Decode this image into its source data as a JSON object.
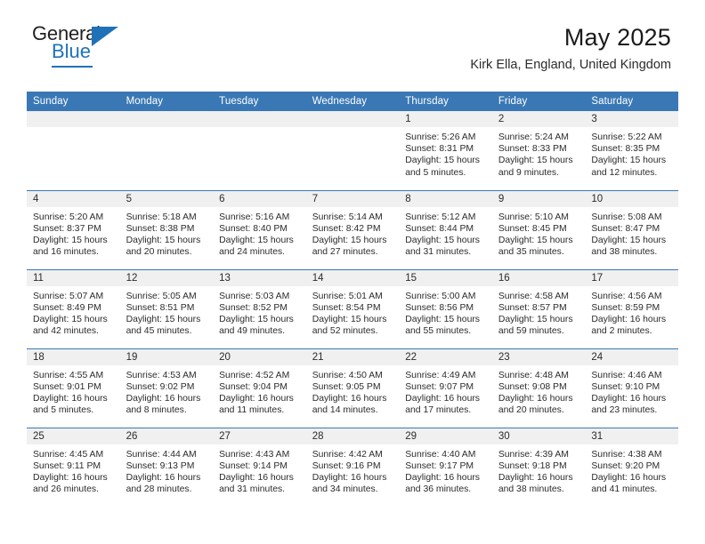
{
  "brand": {
    "name_top": "General",
    "name_bottom": "Blue",
    "flag_icon": "blue-triangle-flag",
    "accent_color": "#1f72b8"
  },
  "header": {
    "title": "May 2025",
    "subtitle": "Kirk Ella, England, United Kingdom"
  },
  "calendar": {
    "header_color": "#3a78b5",
    "daynum_background": "#f0f0f0",
    "weekday_headers": [
      "Sunday",
      "Monday",
      "Tuesday",
      "Wednesday",
      "Thursday",
      "Friday",
      "Saturday"
    ],
    "weeks": [
      [
        {
          "day": "",
          "info": ""
        },
        {
          "day": "",
          "info": ""
        },
        {
          "day": "",
          "info": ""
        },
        {
          "day": "",
          "info": ""
        },
        {
          "day": "1",
          "info": "Sunrise: 5:26 AM\nSunset: 8:31 PM\nDaylight: 15 hours\nand 5 minutes."
        },
        {
          "day": "2",
          "info": "Sunrise: 5:24 AM\nSunset: 8:33 PM\nDaylight: 15 hours\nand 9 minutes."
        },
        {
          "day": "3",
          "info": "Sunrise: 5:22 AM\nSunset: 8:35 PM\nDaylight: 15 hours\nand 12 minutes."
        }
      ],
      [
        {
          "day": "4",
          "info": "Sunrise: 5:20 AM\nSunset: 8:37 PM\nDaylight: 15 hours\nand 16 minutes."
        },
        {
          "day": "5",
          "info": "Sunrise: 5:18 AM\nSunset: 8:38 PM\nDaylight: 15 hours\nand 20 minutes."
        },
        {
          "day": "6",
          "info": "Sunrise: 5:16 AM\nSunset: 8:40 PM\nDaylight: 15 hours\nand 24 minutes."
        },
        {
          "day": "7",
          "info": "Sunrise: 5:14 AM\nSunset: 8:42 PM\nDaylight: 15 hours\nand 27 minutes."
        },
        {
          "day": "8",
          "info": "Sunrise: 5:12 AM\nSunset: 8:44 PM\nDaylight: 15 hours\nand 31 minutes."
        },
        {
          "day": "9",
          "info": "Sunrise: 5:10 AM\nSunset: 8:45 PM\nDaylight: 15 hours\nand 35 minutes."
        },
        {
          "day": "10",
          "info": "Sunrise: 5:08 AM\nSunset: 8:47 PM\nDaylight: 15 hours\nand 38 minutes."
        }
      ],
      [
        {
          "day": "11",
          "info": "Sunrise: 5:07 AM\nSunset: 8:49 PM\nDaylight: 15 hours\nand 42 minutes."
        },
        {
          "day": "12",
          "info": "Sunrise: 5:05 AM\nSunset: 8:51 PM\nDaylight: 15 hours\nand 45 minutes."
        },
        {
          "day": "13",
          "info": "Sunrise: 5:03 AM\nSunset: 8:52 PM\nDaylight: 15 hours\nand 49 minutes."
        },
        {
          "day": "14",
          "info": "Sunrise: 5:01 AM\nSunset: 8:54 PM\nDaylight: 15 hours\nand 52 minutes."
        },
        {
          "day": "15",
          "info": "Sunrise: 5:00 AM\nSunset: 8:56 PM\nDaylight: 15 hours\nand 55 minutes."
        },
        {
          "day": "16",
          "info": "Sunrise: 4:58 AM\nSunset: 8:57 PM\nDaylight: 15 hours\nand 59 minutes."
        },
        {
          "day": "17",
          "info": "Sunrise: 4:56 AM\nSunset: 8:59 PM\nDaylight: 16 hours\nand 2 minutes."
        }
      ],
      [
        {
          "day": "18",
          "info": "Sunrise: 4:55 AM\nSunset: 9:01 PM\nDaylight: 16 hours\nand 5 minutes."
        },
        {
          "day": "19",
          "info": "Sunrise: 4:53 AM\nSunset: 9:02 PM\nDaylight: 16 hours\nand 8 minutes."
        },
        {
          "day": "20",
          "info": "Sunrise: 4:52 AM\nSunset: 9:04 PM\nDaylight: 16 hours\nand 11 minutes."
        },
        {
          "day": "21",
          "info": "Sunrise: 4:50 AM\nSunset: 9:05 PM\nDaylight: 16 hours\nand 14 minutes."
        },
        {
          "day": "22",
          "info": "Sunrise: 4:49 AM\nSunset: 9:07 PM\nDaylight: 16 hours\nand 17 minutes."
        },
        {
          "day": "23",
          "info": "Sunrise: 4:48 AM\nSunset: 9:08 PM\nDaylight: 16 hours\nand 20 minutes."
        },
        {
          "day": "24",
          "info": "Sunrise: 4:46 AM\nSunset: 9:10 PM\nDaylight: 16 hours\nand 23 minutes."
        }
      ],
      [
        {
          "day": "25",
          "info": "Sunrise: 4:45 AM\nSunset: 9:11 PM\nDaylight: 16 hours\nand 26 minutes."
        },
        {
          "day": "26",
          "info": "Sunrise: 4:44 AM\nSunset: 9:13 PM\nDaylight: 16 hours\nand 28 minutes."
        },
        {
          "day": "27",
          "info": "Sunrise: 4:43 AM\nSunset: 9:14 PM\nDaylight: 16 hours\nand 31 minutes."
        },
        {
          "day": "28",
          "info": "Sunrise: 4:42 AM\nSunset: 9:16 PM\nDaylight: 16 hours\nand 34 minutes."
        },
        {
          "day": "29",
          "info": "Sunrise: 4:40 AM\nSunset: 9:17 PM\nDaylight: 16 hours\nand 36 minutes."
        },
        {
          "day": "30",
          "info": "Sunrise: 4:39 AM\nSunset: 9:18 PM\nDaylight: 16 hours\nand 38 minutes."
        },
        {
          "day": "31",
          "info": "Sunrise: 4:38 AM\nSunset: 9:20 PM\nDaylight: 16 hours\nand 41 minutes."
        }
      ]
    ]
  }
}
